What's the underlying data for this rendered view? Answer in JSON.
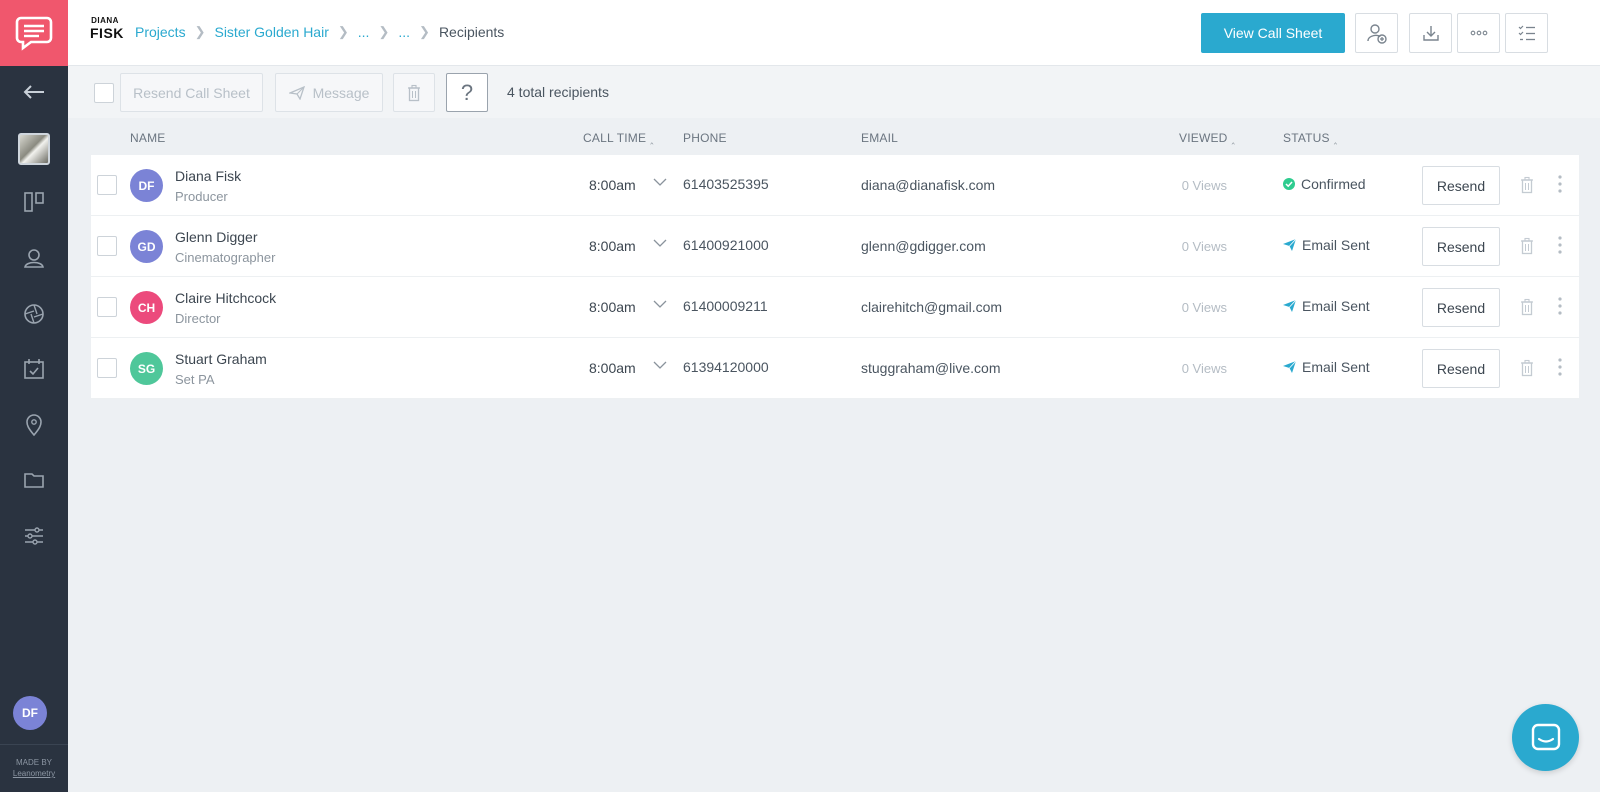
{
  "sidebar": {
    "user_initials": "DF",
    "footer_line1": "MADE BY",
    "footer_line2": "Leanometry",
    "nav_icons": [
      "back-arrow-icon",
      "project-thumbnail",
      "board-icon",
      "contacts-icon",
      "aperture-icon",
      "calendar-check-icon",
      "location-pin-icon",
      "folder-icon",
      "sliders-icon"
    ]
  },
  "header": {
    "brand_line1": "DIANA",
    "brand_line2": "FISK",
    "breadcrumbs": [
      {
        "label": "Projects",
        "link": true
      },
      {
        "label": "Sister Golden Hair",
        "link": true
      },
      {
        "label": "...",
        "link": true
      },
      {
        "label": "...",
        "link": true
      },
      {
        "label": "Recipients",
        "link": false
      }
    ],
    "view_call_sheet_label": "View Call Sheet",
    "action_icons": [
      "add-contact-icon",
      "download-icon",
      "more-icon",
      "checklist-icon"
    ]
  },
  "toolbar": {
    "resend_label": "Resend Call Sheet",
    "message_label": "Message",
    "help_label": "?",
    "total_label": "4 total recipients"
  },
  "columns": {
    "name": "NAME",
    "call_time": "CALL TIME",
    "phone": "PHONE",
    "email": "EMAIL",
    "viewed": "VIEWED",
    "status": "STATUS"
  },
  "colors": {
    "accent": "#2aa9cf",
    "logo_bg": "#f0576d",
    "sidebar_bg": "#2a3340",
    "confirmed": "#2ecc8f",
    "sent": "#2aa9cf"
  },
  "recipients": [
    {
      "initials": "DF",
      "name": "Diana Fisk",
      "role": "Producer",
      "call_time": "8:00am",
      "phone": "61403525395",
      "email": "diana@dianafisk.com",
      "views": "0 Views",
      "status": "Confirmed",
      "status_type": "confirmed",
      "avatar_color": "#7b83d6",
      "action": "Resend"
    },
    {
      "initials": "GD",
      "name": "Glenn Digger",
      "role": "Cinematographer",
      "call_time": "8:00am",
      "phone": "61400921000",
      "email": "glenn@gdigger.com",
      "views": "0 Views",
      "status": "Email Sent",
      "status_type": "sent",
      "avatar_color": "#7b83d6",
      "action": "Resend"
    },
    {
      "initials": "CH",
      "name": "Claire Hitchcock",
      "role": "Director",
      "call_time": "8:00am",
      "phone": "61400009211",
      "email": "clairehitch@gmail.com",
      "views": "0 Views",
      "status": "Email Sent",
      "status_type": "sent",
      "avatar_color": "#ec4a7c",
      "action": "Resend"
    },
    {
      "initials": "SG",
      "name": "Stuart Graham",
      "role": "Set PA",
      "call_time": "8:00am",
      "phone": "61394120000",
      "email": "stuggraham@live.com",
      "views": "0 Views",
      "status": "Email Sent",
      "status_type": "sent",
      "avatar_color": "#4fc79a",
      "action": "Resend"
    }
  ]
}
